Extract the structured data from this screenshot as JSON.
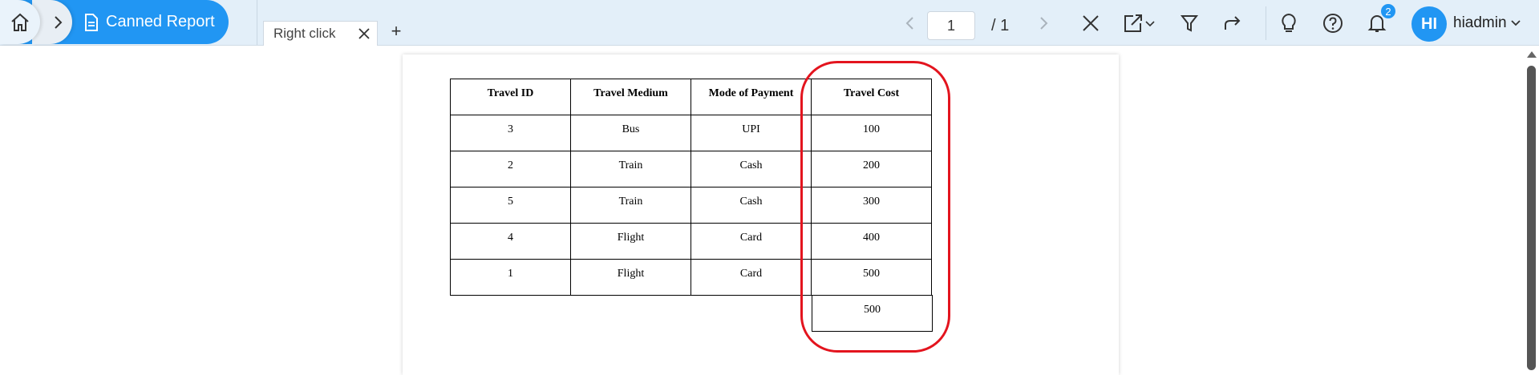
{
  "breadcrumb": {
    "current_label": "Canned Report"
  },
  "tabs": [
    {
      "label": "Right click"
    }
  ],
  "add_tab_label": "+",
  "pager": {
    "current_page": "1",
    "total_label": "/ 1"
  },
  "notifications": {
    "count": "2"
  },
  "user": {
    "initials": "HI",
    "name": "hiadmin"
  },
  "report": {
    "columns": [
      "Travel ID",
      "Travel Medium",
      "Mode of Payment",
      "Travel Cost"
    ],
    "rows": [
      [
        "3",
        "Bus",
        "UPI",
        "100"
      ],
      [
        "2",
        "Train",
        "Cash",
        "200"
      ],
      [
        "5",
        "Train",
        "Cash",
        "300"
      ],
      [
        "4",
        "Flight",
        "Card",
        "400"
      ],
      [
        "1",
        "Flight",
        "Card",
        "500"
      ]
    ],
    "extra_cost_cell": "500"
  },
  "colors": {
    "accent": "#2196f3",
    "highlight": "#e3141e",
    "topbar": "#e3eff9"
  }
}
